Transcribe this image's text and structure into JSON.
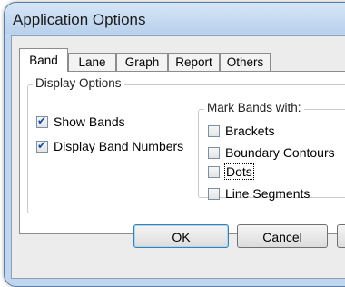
{
  "window": {
    "title": "Application Options"
  },
  "tabs": [
    {
      "label": "Band",
      "active": true
    },
    {
      "label": "Lane",
      "active": false
    },
    {
      "label": "Graph",
      "active": false
    },
    {
      "label": "Report",
      "active": false
    },
    {
      "label": "Others",
      "active": false
    }
  ],
  "display_options": {
    "legend": "Display Options",
    "show_bands": {
      "label": "Show Bands",
      "checked": true
    },
    "display_band_numbers": {
      "label": "Display Band Numbers",
      "checked": true
    }
  },
  "mark_bands": {
    "legend": "Mark Bands with:",
    "options": [
      {
        "label": "Brackets",
        "checked": false
      },
      {
        "label": "Boundary Contours",
        "checked": false
      },
      {
        "label": "Dots",
        "checked": false
      },
      {
        "label": "Line Segments",
        "checked": false
      }
    ]
  },
  "buttons": {
    "ok": "OK",
    "cancel": "Cancel"
  }
}
